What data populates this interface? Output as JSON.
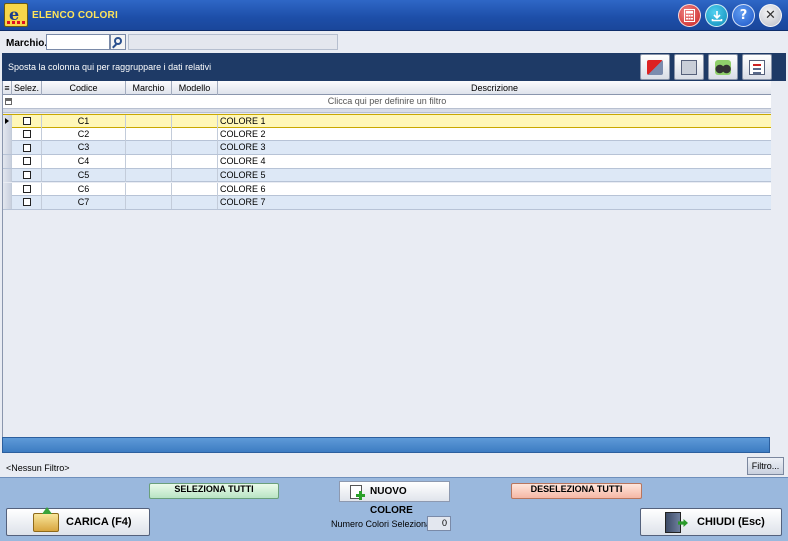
{
  "window": {
    "title": "ELENCO COLORI",
    "logo_letter": "e"
  },
  "titlebar_buttons": {
    "calculator_icon": "calculator-icon",
    "download_icon": "download-icon",
    "help_glyph": "?",
    "close_glyph": "✕"
  },
  "filter": {
    "marchio_label": "Marchio..",
    "marchio_value": "",
    "marchio_description": ""
  },
  "group_panel": {
    "hint": "Sposta la colonna qui per raggruppare i dati relativi",
    "tools": [
      "export-icon",
      "print-icon",
      "binoculars-icon",
      "report-icon"
    ]
  },
  "grid": {
    "columns": {
      "selez": "Selez.",
      "codice": "Codice",
      "marchio": "Marchio",
      "modello": "Modello",
      "descrizione": "Descrizione"
    },
    "filter_row_text": "Clicca qui per definire un filtro",
    "rows": [
      {
        "codice": "C1",
        "marchio": "",
        "modello": "",
        "descrizione": "COLORE 1",
        "selected": false
      },
      {
        "codice": "C2",
        "marchio": "",
        "modello": "",
        "descrizione": "COLORE 2",
        "selected": false
      },
      {
        "codice": "C3",
        "marchio": "",
        "modello": "",
        "descrizione": "COLORE 3",
        "selected": false
      },
      {
        "codice": "C4",
        "marchio": "",
        "modello": "",
        "descrizione": "COLORE 4",
        "selected": false
      },
      {
        "codice": "C5",
        "marchio": "",
        "modello": "",
        "descrizione": "COLORE 5",
        "selected": false
      },
      {
        "codice": "C6",
        "marchio": "",
        "modello": "",
        "descrizione": "COLORE 6",
        "selected": false
      },
      {
        "codice": "C7",
        "marchio": "",
        "modello": "",
        "descrizione": "COLORE 7",
        "selected": false
      }
    ],
    "active_row": 0
  },
  "status": {
    "filter_state": "<Nessun Filtro>",
    "filter_button": "Filtro..."
  },
  "actions": {
    "select_all": "SELEZIONA TUTTI",
    "new_color": "NUOVO COLORE",
    "deselect_all": "DESELEZIONA TUTTI",
    "load": "CARICA (F4)",
    "close": "CHIUDI  (Esc)",
    "count_label": "Numero Colori Selezionati:",
    "count_value": "0"
  },
  "colors": {
    "titlebar": "#1d4ea8",
    "title_text": "#ffe55a",
    "selected_row": "#fff7b8",
    "alt_row": "#dde8f6",
    "group_panel": "#1e3a66",
    "action_bar": "#9ab8dd"
  }
}
